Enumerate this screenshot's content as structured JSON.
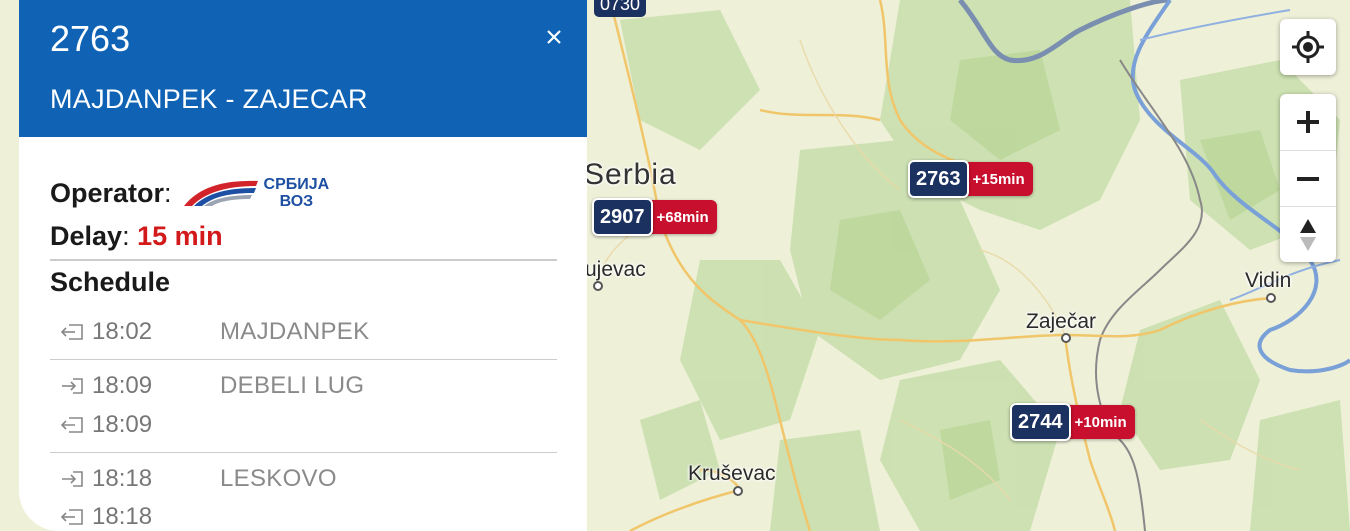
{
  "panel": {
    "train_number": "2763",
    "route": "MAJDANPEK - ZAJECAR",
    "close_symbol": "×",
    "operator_label": "Operator",
    "operator_logo_text": [
      "СРБИЈА",
      "ВОЗ"
    ],
    "delay_label": "Delay",
    "delay_value": "15 min",
    "schedule_title": "Schedule",
    "stops": [
      {
        "station": "MAJDANPEK",
        "arrival": null,
        "departure": "18:02"
      },
      {
        "station": "DEBELI LUG",
        "arrival": "18:09",
        "departure": "18:09"
      },
      {
        "station": "LESKOVO",
        "arrival": "18:18",
        "departure": "18:18"
      }
    ]
  },
  "map": {
    "places": {
      "serbia": "Serbia",
      "kragujevac": "ujevac",
      "zajecar": "Zaječar",
      "vidin": "Vidin",
      "krusevac": "Kruševac",
      "partial_top": "0730"
    },
    "trains": [
      {
        "number": "2763",
        "delay": "+15min"
      },
      {
        "number": "2907",
        "delay": "+68min"
      },
      {
        "number": "2744",
        "delay": "+10min"
      }
    ],
    "controls": {
      "locate": "locate-icon",
      "zoom_in": "+",
      "zoom_out": "−",
      "compass": "compass-icon"
    }
  },
  "colors": {
    "header_blue": "#0f62b4",
    "train_badge": "#1b3160",
    "delay_red": "#c8102e"
  }
}
